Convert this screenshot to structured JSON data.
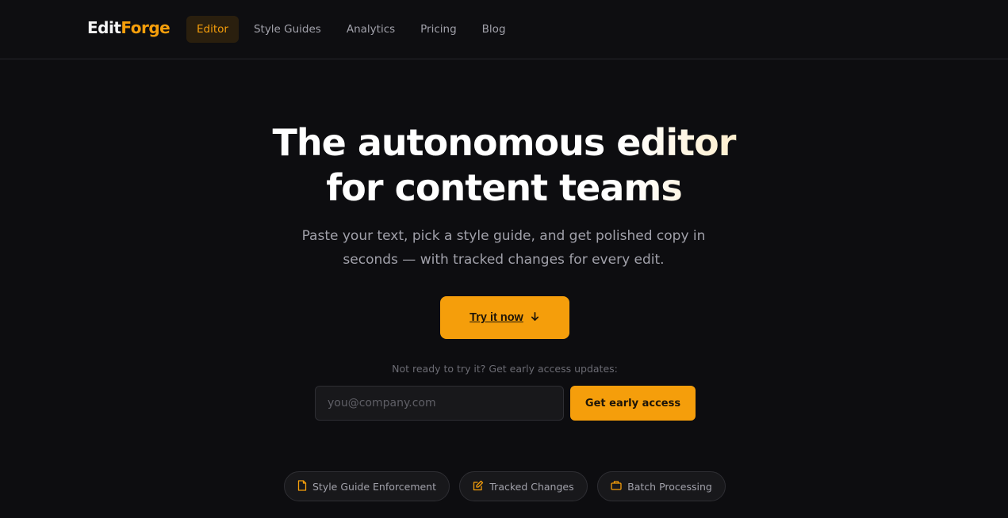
{
  "brand": {
    "part1": "Edit",
    "part2": "Forge"
  },
  "nav": {
    "items": [
      {
        "label": "Editor",
        "active": true
      },
      {
        "label": "Style Guides",
        "active": false
      },
      {
        "label": "Analytics",
        "active": false
      },
      {
        "label": "Pricing",
        "active": false
      },
      {
        "label": "Blog",
        "active": false
      }
    ]
  },
  "hero": {
    "title_line1": "The autonomous editor",
    "title_line2": "for content teams",
    "subtitle_line1": "Paste your text, pick a style guide, and get polished copy in",
    "subtitle_line2": "seconds — with tracked changes for every edit.",
    "cta_label": "Try it now",
    "cta_icon": "arrow-down-icon"
  },
  "early_access": {
    "note": "Not ready to try it? Get early access updates:",
    "email_value": "",
    "email_placeholder": "you@company.com",
    "button_label": "Get early access"
  },
  "features": [
    {
      "label": "Style Guide Enforcement",
      "icon": "document-icon"
    },
    {
      "label": "Tracked Changes",
      "icon": "edit-icon"
    },
    {
      "label": "Batch Processing",
      "icon": "briefcase-icon"
    }
  ],
  "colors": {
    "background": "#0d0d10",
    "accent": "#f59e0b",
    "text_muted": "#a1a1aa"
  }
}
